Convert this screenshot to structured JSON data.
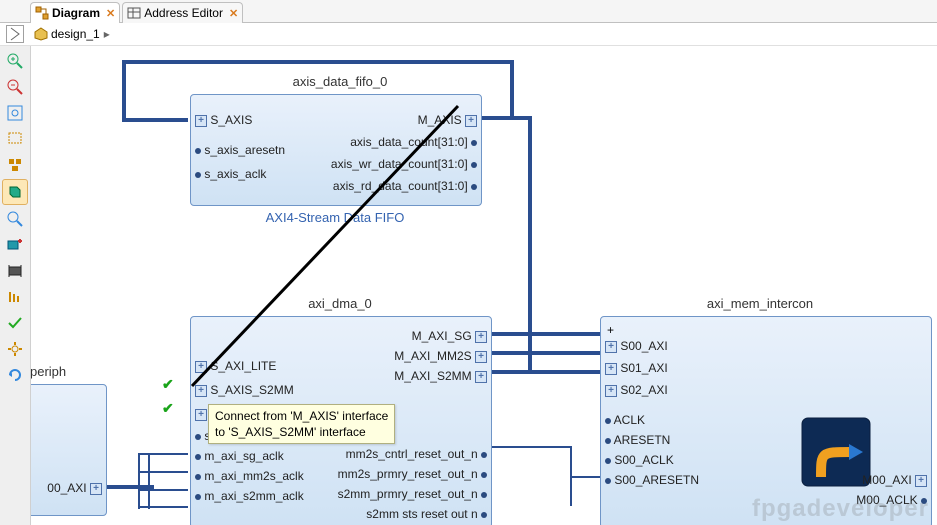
{
  "tabs": [
    {
      "label": "Diagram",
      "active": true
    },
    {
      "label": "Address Editor",
      "active": false
    }
  ],
  "crumb": {
    "design": "design_1"
  },
  "sidebar_tools": [
    {
      "name": "zoom-in-icon",
      "svg": "mag-plus",
      "on": false
    },
    {
      "name": "zoom-out-icon",
      "svg": "mag-minus",
      "on": false
    },
    {
      "name": "zoom-fit-icon",
      "svg": "mag-fit",
      "on": false
    },
    {
      "name": "marquee-icon",
      "svg": "marquee",
      "on": false
    },
    {
      "name": "auto-layout-icon",
      "svg": "layout",
      "on": false
    },
    {
      "name": "highlight-icon",
      "svg": "layers",
      "on": true
    },
    {
      "name": "search-icon",
      "svg": "mag",
      "on": false
    },
    {
      "name": "add-ip-icon",
      "svg": "chip-plus",
      "on": false
    },
    {
      "name": "constraints-icon",
      "svg": "chip",
      "on": false
    },
    {
      "name": "bars-icon",
      "svg": "bars",
      "on": false
    },
    {
      "name": "validate-icon",
      "svg": "check",
      "on": false
    },
    {
      "name": "settings-icon",
      "svg": "gear",
      "on": false
    },
    {
      "name": "regenerate-icon",
      "svg": "refresh",
      "on": false
    }
  ],
  "blocks": {
    "fifo": {
      "title": "axis_data_fifo_0",
      "subtitle": "AXI4-Stream Data FIFO",
      "left_ports": [
        "S_AXIS",
        "s_axis_aresetn",
        "s_axis_aclk"
      ],
      "right_ports": [
        "M_AXIS",
        "axis_data_count[31:0]",
        "axis_wr_data_count[31:0]",
        "axis_rd_data_count[31:0]"
      ]
    },
    "dma": {
      "title": "axi_dma_0",
      "left_ports": [
        "S_AXI_LITE",
        "S_AXIS_S2MM",
        "S_AXIS_…",
        "s_axi_lite_a…",
        "m_axi_sg_aclk",
        "m_axi_mm2s_aclk",
        "m_axi_s2mm_aclk"
      ],
      "right_ports": [
        "M_AXI_SG",
        "M_AXI_MM2S",
        "M_AXI_S2MM",
        "mm2s_cntrl_reset_out_n",
        "mm2s_prmry_reset_out_n",
        "s2mm_prmry_reset_out_n",
        "s2mm sts reset out n"
      ]
    },
    "intercon": {
      "title": "axi_mem_intercon",
      "left_ports": [
        "S00_AXI",
        "S01_AXI",
        "S02_AXI",
        "ACLK",
        "ARESETN",
        "S00_ACLK",
        "S00_ARESETN"
      ],
      "right_ports": [
        "M00_AXI",
        "M00_ACLK"
      ]
    },
    "periph": {
      "title": "periph",
      "right_port": "00_AXI"
    }
  },
  "tooltip": {
    "line1": "Connect from 'M_AXIS' interface",
    "line2": "to 'S_AXIS_S2MM' interface"
  },
  "watermark": "fpgadeveloper"
}
